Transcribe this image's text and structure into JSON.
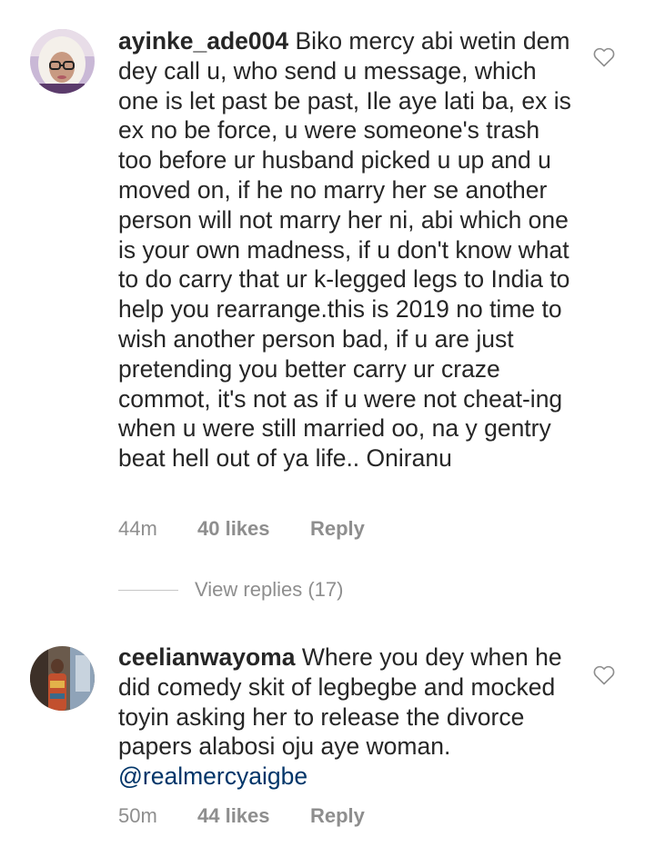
{
  "comments": [
    {
      "username": "ayinke_ade004",
      "text": "Biko mercy abi wetin dem dey call u, who send u message, which one is let past be past, Ile aye lati ba, ex is ex no be force, u were someone's trash too before ur husband picked u up and u moved on, if he no marry her se another person will not marry her ni, abi which one is your own madness, if u don't know what to do carry that ur k-legged legs to India to help you rearrange.this is 2019 no time to wish another person bad, if u are just pretending you better carry ur craze commot, it's not as if u were not cheat-ing when u were still married oo, na y gentry beat hell out of ya life.. Oniranu",
      "time": "44m",
      "likes": "40 likes",
      "reply": "Reply",
      "view_replies": "View replies (17)"
    },
    {
      "username": "ceelianwayoma",
      "text": "Where you dey when he did comedy skit of legbegbe and mocked toyin asking her to release the divorce papers alabosi oju aye woman.",
      "mention": "@realmercyaigbe",
      "time": "50m",
      "likes": "44 likes",
      "reply": "Reply"
    }
  ],
  "icons": {
    "like": "heart-outline-icon"
  },
  "colors": {
    "text": "#262626",
    "muted": "#8e8e8e",
    "mention": "#003569",
    "divider": "#c7c7c7"
  }
}
